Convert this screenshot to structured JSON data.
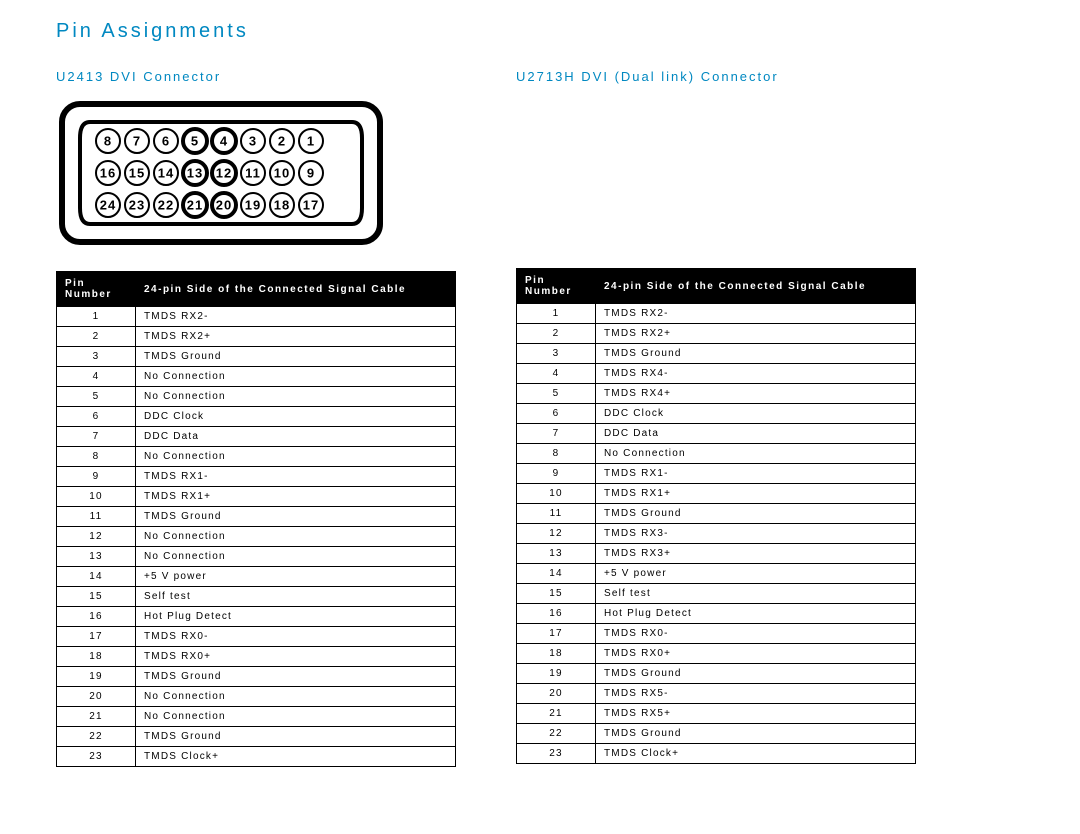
{
  "title": "Pin Assignments",
  "left": {
    "subtitle": "U2413 DVI Connector",
    "header_num": "Pin Number",
    "header_sig": "24-pin Side of the Connected Signal Cable",
    "rows": [
      {
        "n": "1",
        "s": "TMDS RX2-"
      },
      {
        "n": "2",
        "s": "TMDS RX2+"
      },
      {
        "n": "3",
        "s": "TMDS Ground"
      },
      {
        "n": "4",
        "s": "No Connection"
      },
      {
        "n": "5",
        "s": "No Connection"
      },
      {
        "n": "6",
        "s": "DDC Clock"
      },
      {
        "n": "7",
        "s": "DDC Data"
      },
      {
        "n": "8",
        "s": "No Connection"
      },
      {
        "n": "9",
        "s": "TMDS RX1-"
      },
      {
        "n": "10",
        "s": "TMDS RX1+"
      },
      {
        "n": "11",
        "s": "TMDS Ground"
      },
      {
        "n": "12",
        "s": "No Connection"
      },
      {
        "n": "13",
        "s": "No Connection"
      },
      {
        "n": "14",
        "s": "+5 V power"
      },
      {
        "n": "15",
        "s": "Self test"
      },
      {
        "n": "16",
        "s": "Hot Plug Detect"
      },
      {
        "n": "17",
        "s": "TMDS RX0-"
      },
      {
        "n": "18",
        "s": "TMDS RX0+"
      },
      {
        "n": "19",
        "s": "TMDS Ground"
      },
      {
        "n": "20",
        "s": "No Connection"
      },
      {
        "n": "21",
        "s": "No Connection"
      },
      {
        "n": "22",
        "s": "TMDS Ground"
      },
      {
        "n": "23",
        "s": "TMDS Clock+"
      }
    ]
  },
  "right": {
    "subtitle": "U2713H DVI (Dual link) Connector",
    "header_num": "Pin Number",
    "header_sig": "24-pin Side of the Connected Signal Cable",
    "rows": [
      {
        "n": "1",
        "s": "TMDS RX2-"
      },
      {
        "n": "2",
        "s": "TMDS RX2+"
      },
      {
        "n": "3",
        "s": "TMDS Ground"
      },
      {
        "n": "4",
        "s": "TMDS RX4-"
      },
      {
        "n": "5",
        "s": "TMDS RX4+"
      },
      {
        "n": "6",
        "s": "DDC Clock"
      },
      {
        "n": "7",
        "s": "DDC Data"
      },
      {
        "n": "8",
        "s": "No Connection"
      },
      {
        "n": "9",
        "s": "TMDS RX1-"
      },
      {
        "n": "10",
        "s": "TMDS RX1+"
      },
      {
        "n": "11",
        "s": "TMDS Ground"
      },
      {
        "n": "12",
        "s": "TMDS RX3-"
      },
      {
        "n": "13",
        "s": "TMDS RX3+"
      },
      {
        "n": "14",
        "s": "+5 V power"
      },
      {
        "n": "15",
        "s": "Self test"
      },
      {
        "n": "16",
        "s": "Hot Plug Detect"
      },
      {
        "n": "17",
        "s": "TMDS RX0-"
      },
      {
        "n": "18",
        "s": "TMDS RX0+"
      },
      {
        "n": "19",
        "s": "TMDS Ground"
      },
      {
        "n": "20",
        "s": "TMDS RX5-"
      },
      {
        "n": "21",
        "s": "TMDS RX5+"
      },
      {
        "n": "22",
        "s": "TMDS Ground"
      },
      {
        "n": "23",
        "s": "TMDS Clock+"
      }
    ]
  },
  "connector": {
    "rows": [
      [
        8,
        7,
        6,
        5,
        4,
        3,
        2,
        1
      ],
      [
        16,
        15,
        14,
        13,
        12,
        11,
        10,
        9
      ],
      [
        24,
        23,
        22,
        21,
        20,
        19,
        18,
        17
      ]
    ],
    "bold": [
      4,
      5,
      12,
      13,
      20,
      21
    ]
  }
}
